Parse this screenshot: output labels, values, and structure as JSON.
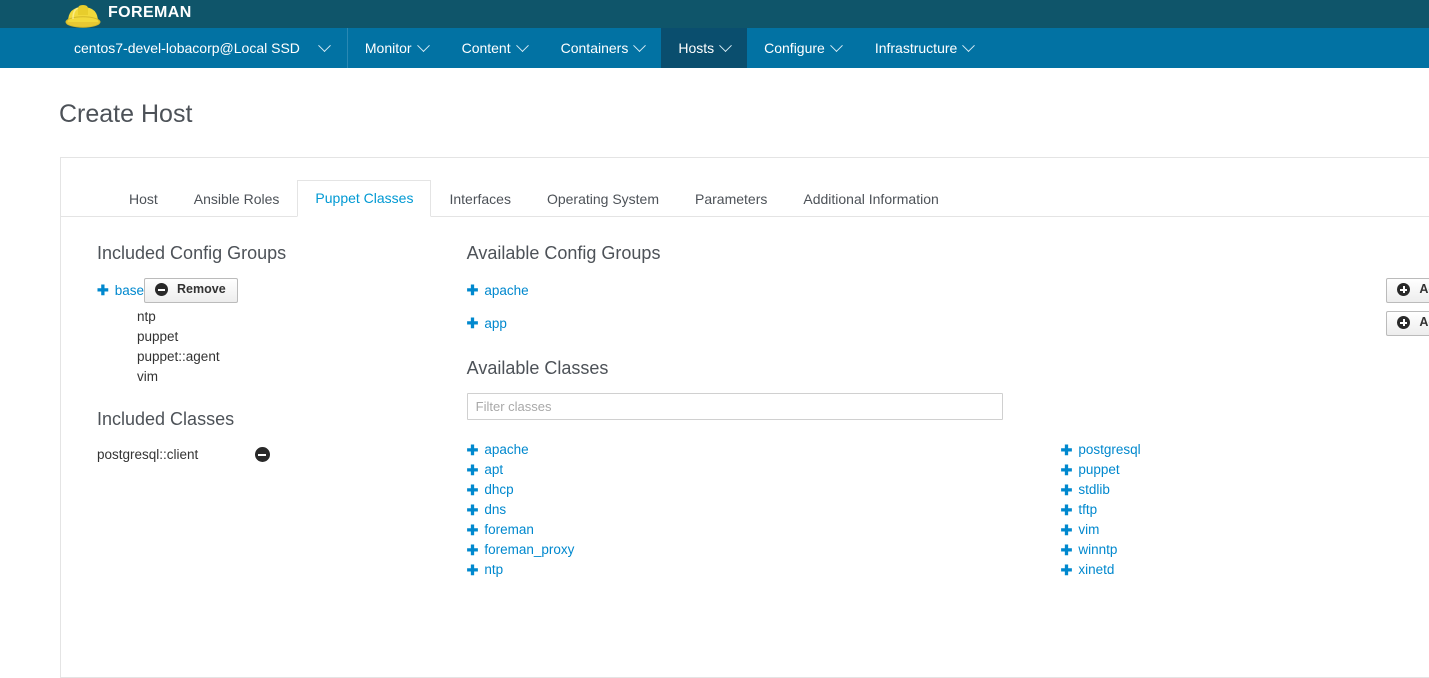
{
  "brand": {
    "name": "FOREMAN",
    "logo_icon": "hard-hat-icon",
    "bar_color": "#0f556a"
  },
  "nav": {
    "org_selector": "centos7-devel-lobacorp@Local SSD",
    "bar_color": "#0272a3",
    "active_color": "#0a4e6e",
    "items": [
      {
        "label": "Monitor",
        "active": false
      },
      {
        "label": "Content",
        "active": false
      },
      {
        "label": "Containers",
        "active": false
      },
      {
        "label": "Hosts",
        "active": true
      },
      {
        "label": "Configure",
        "active": false
      },
      {
        "label": "Infrastructure",
        "active": false
      }
    ]
  },
  "page": {
    "title": "Create Host"
  },
  "tabs": [
    {
      "label": "Host",
      "active": false
    },
    {
      "label": "Ansible Roles",
      "active": false
    },
    {
      "label": "Puppet Classes",
      "active": true
    },
    {
      "label": "Interfaces",
      "active": false
    },
    {
      "label": "Operating System",
      "active": false
    },
    {
      "label": "Parameters",
      "active": false
    },
    {
      "label": "Additional Information",
      "active": false
    }
  ],
  "included_config_groups": {
    "title": "Included Config Groups",
    "remove_label": "Remove",
    "groups": [
      {
        "name": "base",
        "classes": [
          "ntp",
          "puppet",
          "puppet::agent",
          "vim"
        ]
      }
    ]
  },
  "available_config_groups": {
    "title": "Available Config Groups",
    "add_label": "Add",
    "groups": [
      {
        "name": "apache"
      },
      {
        "name": "app"
      }
    ]
  },
  "included_classes": {
    "title": "Included Classes",
    "classes": [
      "postgresql::client"
    ]
  },
  "available_classes": {
    "title": "Available Classes",
    "filter_placeholder": "Filter classes",
    "filter_value": "",
    "column_left": [
      "apache",
      "apt",
      "dhcp",
      "dns",
      "foreman",
      "foreman_proxy",
      "ntp"
    ],
    "column_right": [
      "postgresql",
      "puppet",
      "stdlib",
      "tftp",
      "vim",
      "winntp",
      "xinetd"
    ]
  },
  "colors": {
    "link": "#0088ce",
    "active_tab_text": "#0099d3",
    "heading": "#4d5258"
  }
}
